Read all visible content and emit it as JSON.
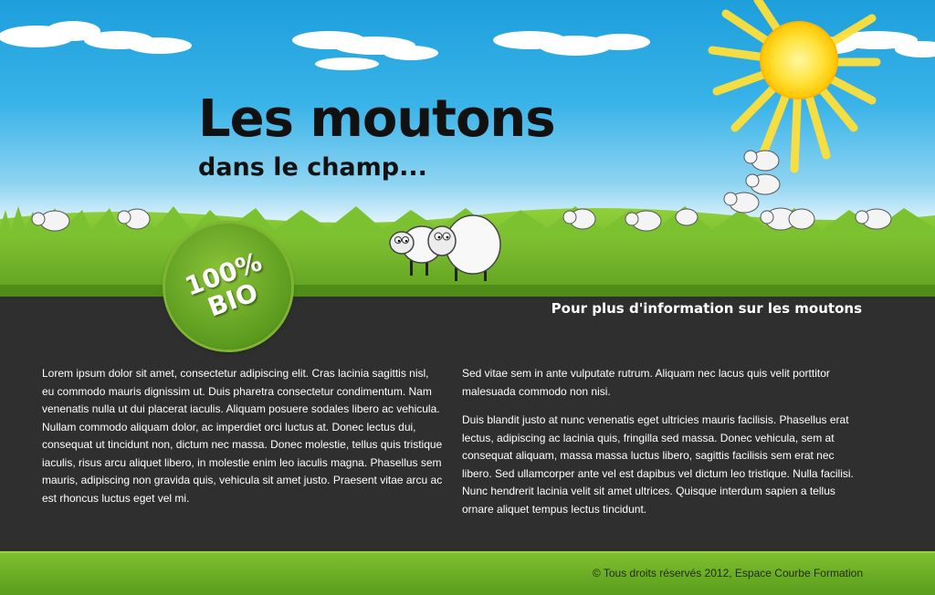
{
  "header": {
    "title": "Les moutons",
    "subtitle": "dans le champ...",
    "badge": {
      "line1": "100%",
      "line2": "BIO"
    },
    "info_link": "Pour plus d'information sur les moutons"
  },
  "content": {
    "left_column": [
      "Lorem ipsum dolor sit amet, consectetur adipiscing elit. Cras lacinia sagittis nisl, eu commodo mauris dignissim ut. Duis pharetra consectetur condimentum. Nam venenatis nulla ut dui placerat iaculis. Aliquam posuere sodales libero ac vehicula. Nullam commodo aliquam dolor, ac imperdiet orci luctus at. Donec lectus dui, consequat ut tincidunt non, dictum nec massa. Donec molestie, tellus quis tristique iaculis, risus arcu aliquet libero, in molestie enim leo iaculis magna. Phasellus sem mauris, adipiscing non gravida quis, vehicula sit amet justo. Praesent vitae arcu ac est rhoncus luctus eget vel mi."
    ],
    "right_column": [
      "Sed vitae sem in ante vulputate rutrum. Aliquam nec lacus quis velit porttitor malesuada commodo non nisi.",
      "Duis blandit justo at nunc venenatis eget ultricies mauris facilisis. Phasellus erat lectus, adipiscing ac lacinia quis, fringilla sed massa. Donec vehicula, sem at consequat aliquam, massa massa luctus libero, sagittis facilisis sem erat nec libero. Sed ullamcorper ante vel est dapibus vel dictum leo tristique. Nulla facilisi. Nunc hendrerit lacinia velit sit amet ultrices. Quisque interdum sapien a tellus ornare aliquet tempus lectus tincidunt."
    ]
  },
  "footer": {
    "copyright": "© Tous droits réservés 2012, Espace Courbe Formation"
  },
  "colors": {
    "sky": "#1d9fdc",
    "grass": "#6fb52c",
    "content_bg": "#2f2f2f",
    "footer_green": "#6aad25",
    "sun": "#ffd21a"
  },
  "icons": [
    "sun-illustration",
    "cloud-illustration",
    "sheep-illustration"
  ]
}
